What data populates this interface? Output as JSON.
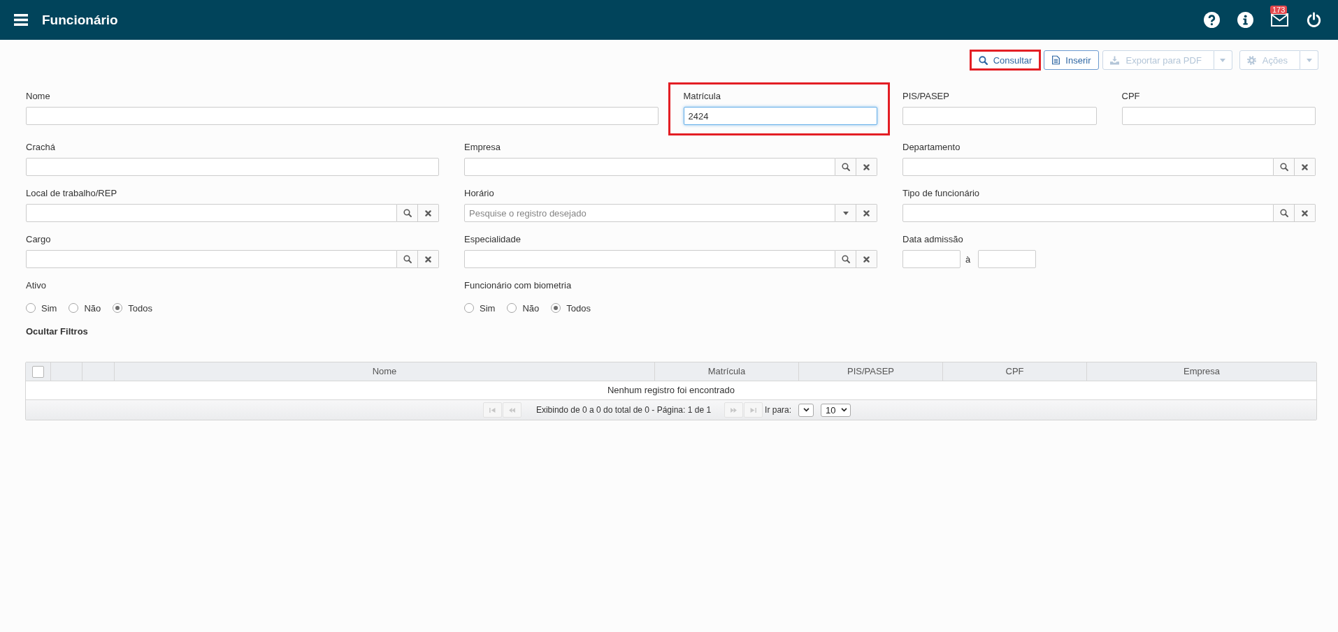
{
  "header": {
    "title": "Funcionário",
    "notification_count": "173"
  },
  "toolbar": [
    {
      "kind": "search",
      "label": "Consultar",
      "disabled": false,
      "split": false,
      "highlighted": true
    },
    {
      "kind": "insert",
      "label": "Inserir",
      "disabled": false,
      "split": false,
      "highlighted": false
    },
    {
      "kind": "export",
      "label": "Exportar para PDF",
      "disabled": true,
      "split": true,
      "highlighted": false
    },
    {
      "kind": "actions",
      "label": "Ações",
      "disabled": true,
      "split": true,
      "highlighted": false
    }
  ],
  "filters": {
    "rows": [
      [
        {
          "kind": "text",
          "label": "Nome",
          "focused": false
        },
        {
          "kind": "text",
          "label": "Matrícula",
          "value": "2424",
          "focused": true,
          "highlighted": true
        },
        {
          "kind": "text",
          "label": "PIS/PASEP",
          "focused": false
        },
        {
          "kind": "text",
          "label": "CPF",
          "focused": false
        }
      ],
      [
        {
          "kind": "text",
          "label": "Crachá",
          "focused": false
        },
        {
          "kind": "lookup",
          "label": "Empresa",
          "focused": false
        },
        {
          "kind": "lookup",
          "label": "Departamento",
          "focused": false
        }
      ],
      [
        {
          "kind": "lookup",
          "label": "Local de trabalho/REP",
          "focused": false
        },
        {
          "kind": "select",
          "label": "Horário",
          "placeholder": "Pesquise o registro desejado",
          "focused": false
        },
        {
          "kind": "lookup",
          "label": "Tipo de funcionário",
          "focused": false
        }
      ],
      [
        {
          "kind": "lookup",
          "label": "Cargo",
          "focused": false
        },
        {
          "kind": "lookup",
          "label": "Especialidade",
          "focused": false
        },
        {
          "kind": "date_range",
          "label": "Data admissão",
          "separator": "à"
        }
      ],
      [
        {
          "kind": "radio",
          "label": "Ativo",
          "options": [
            {
              "label": "Sim",
              "selected": false
            },
            {
              "label": "Não",
              "selected": false
            },
            {
              "label": "Todos",
              "selected": true
            }
          ]
        },
        {
          "kind": "radio",
          "label": "Funcionário com biometria",
          "options": [
            {
              "label": "Sim",
              "selected": false
            },
            {
              "label": "Não",
              "selected": false
            },
            {
              "label": "Todos",
              "selected": true
            }
          ]
        }
      ]
    ],
    "toggle_link": "Ocultar Filtros"
  },
  "table": {
    "columns": [
      {
        "kind": "checkbox",
        "checked": false
      },
      {
        "kind": "blank"
      },
      {
        "kind": "blank"
      },
      {
        "kind": "text",
        "label": "Nome"
      },
      {
        "kind": "text",
        "label": "Matrícula"
      },
      {
        "kind": "text",
        "label": "PIS/PASEP"
      },
      {
        "kind": "text",
        "label": "CPF"
      },
      {
        "kind": "text",
        "label": "Empresa"
      }
    ],
    "empty_message": "Nenhum registro foi encontrado",
    "pager": {
      "buttons": [
        {
          "kind": "first",
          "disabled": true
        },
        {
          "kind": "prev",
          "disabled": true
        },
        {
          "kind": "next",
          "disabled": true
        },
        {
          "kind": "last",
          "disabled": true
        }
      ],
      "summary": "Exibindo de 0 a 0 do total de 0 - Página: 1 de 1",
      "goto_label": "Ir para:",
      "page_size": "10"
    }
  }
}
